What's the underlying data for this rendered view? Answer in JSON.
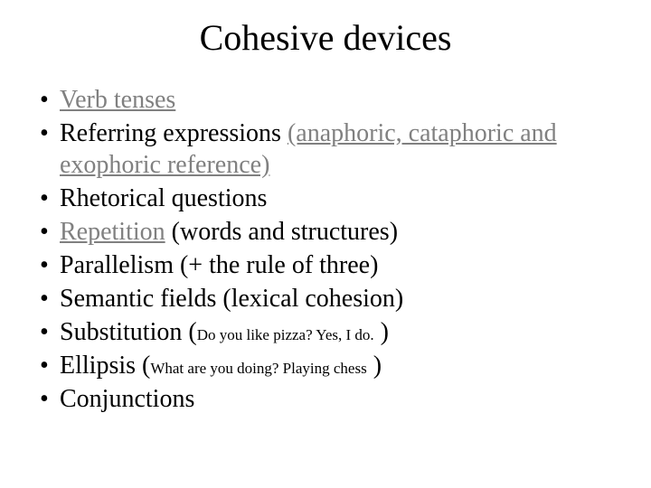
{
  "title": "Cohesive devices",
  "b1_link": "Verb tenses",
  "b2_a": "Referring expressions ",
  "b2_link": "(anaphoric, cataphoric and exophoric reference)",
  "b3": "Rhetorical questions",
  "b4_link": "Repetition",
  "b4_rest": " (words and structures)",
  "b5": "Parallelism (+ the rule of three)",
  "b6": "Semantic fields (lexical cohesion)",
  "b7_a": "Substitution (",
  "b7_small": "Do you like pizza? Yes, I do.",
  "b7_c": " )",
  "b8_a": "Ellipsis (",
  "b8_small": "What are you doing? Playing chess",
  "b8_c": " )",
  "b9": "Conjunctions",
  "bullet_char": "•"
}
